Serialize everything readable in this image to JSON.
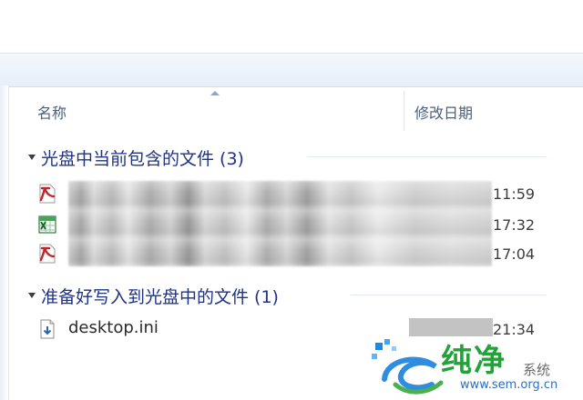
{
  "columns": {
    "name": "名称",
    "date_modified": "修改日期",
    "sort_icon": "sort-ascending-icon"
  },
  "groups": [
    {
      "title": "光盘中当前包含的文件 (3)",
      "files": [
        {
          "icon": "pdf-file-icon",
          "name": "",
          "time": "11:59"
        },
        {
          "icon": "excel-file-icon",
          "name": "",
          "time": "17:32"
        },
        {
          "icon": "pdf-file-icon",
          "name": "",
          "time": "17:04"
        }
      ]
    },
    {
      "title": "准备好写入到光盘中的文件 (1)",
      "files": [
        {
          "icon": "config-file-icon",
          "name": "desktop.ini",
          "time": "21:34"
        }
      ]
    }
  ],
  "watermark": {
    "logo_icon": "watermark-logo-icon",
    "text": "纯净",
    "sub": "系统",
    "url": "www.sem.org.cn"
  }
}
